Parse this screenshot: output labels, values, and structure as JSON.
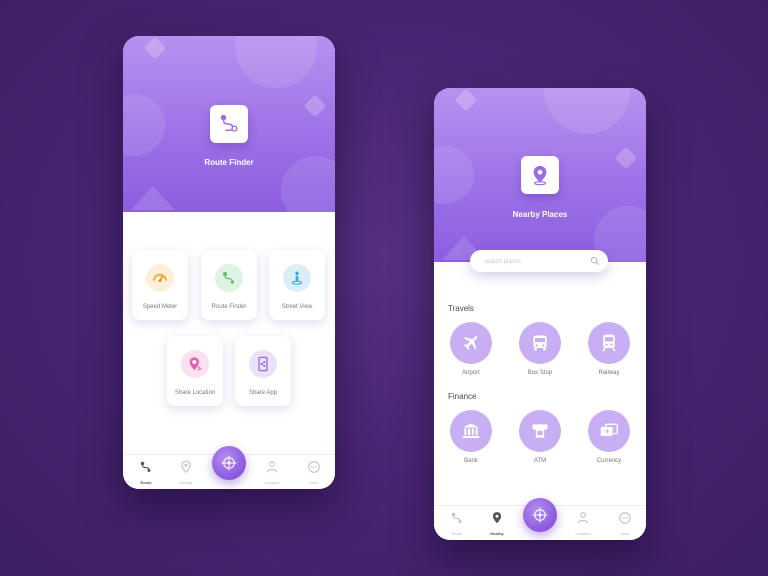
{
  "route_screen": {
    "header_title": "Route Finder",
    "features": [
      {
        "label": "Speed Meter",
        "icon": "speedometer-icon",
        "color": "#f5a623"
      },
      {
        "label": "Route Finder",
        "icon": "route-icon",
        "color": "#5cbf6a"
      },
      {
        "label": "Street View",
        "icon": "street-view-icon",
        "color": "#3aa8d8"
      },
      {
        "label": "Share Location",
        "icon": "location-pin-icon",
        "color": "#e05fb3"
      },
      {
        "label": "Share App",
        "icon": "share-app-icon",
        "color": "#8c5ee0"
      }
    ],
    "nav": [
      {
        "label": "Route",
        "icon": "route-icon",
        "active": true
      },
      {
        "label": "Nearby",
        "icon": "map-pin-icon",
        "active": false
      },
      {
        "label": "Location",
        "icon": "person-icon",
        "active": false
      },
      {
        "label": "More",
        "icon": "more-icon",
        "active": false
      }
    ],
    "fab_icon": "compass-icon"
  },
  "nearby_screen": {
    "header_title": "Nearby Places",
    "search": {
      "placeholder": "search places"
    },
    "sections": [
      {
        "title": "Travels",
        "items": [
          {
            "label": "Airport",
            "icon": "airplane-icon"
          },
          {
            "label": "Bus Stop",
            "icon": "bus-icon"
          },
          {
            "label": "Railway",
            "icon": "train-icon"
          }
        ]
      },
      {
        "title": "Finance",
        "items": [
          {
            "label": "Bank",
            "icon": "bank-icon"
          },
          {
            "label": "ATM",
            "icon": "atm-icon"
          },
          {
            "label": "Currency",
            "icon": "currency-icon"
          }
        ]
      }
    ],
    "nav": [
      {
        "label": "Route",
        "icon": "route-icon",
        "active": false
      },
      {
        "label": "Nearby",
        "icon": "map-pin-icon",
        "active": true
      },
      {
        "label": "Location",
        "icon": "person-icon",
        "active": false
      },
      {
        "label": "More",
        "icon": "more-icon",
        "active": false
      }
    ],
    "fab_icon": "compass-icon"
  },
  "colors": {
    "background": "#4a2674",
    "accent": "#8c5ee0",
    "accent_light": "#c8aef3"
  }
}
